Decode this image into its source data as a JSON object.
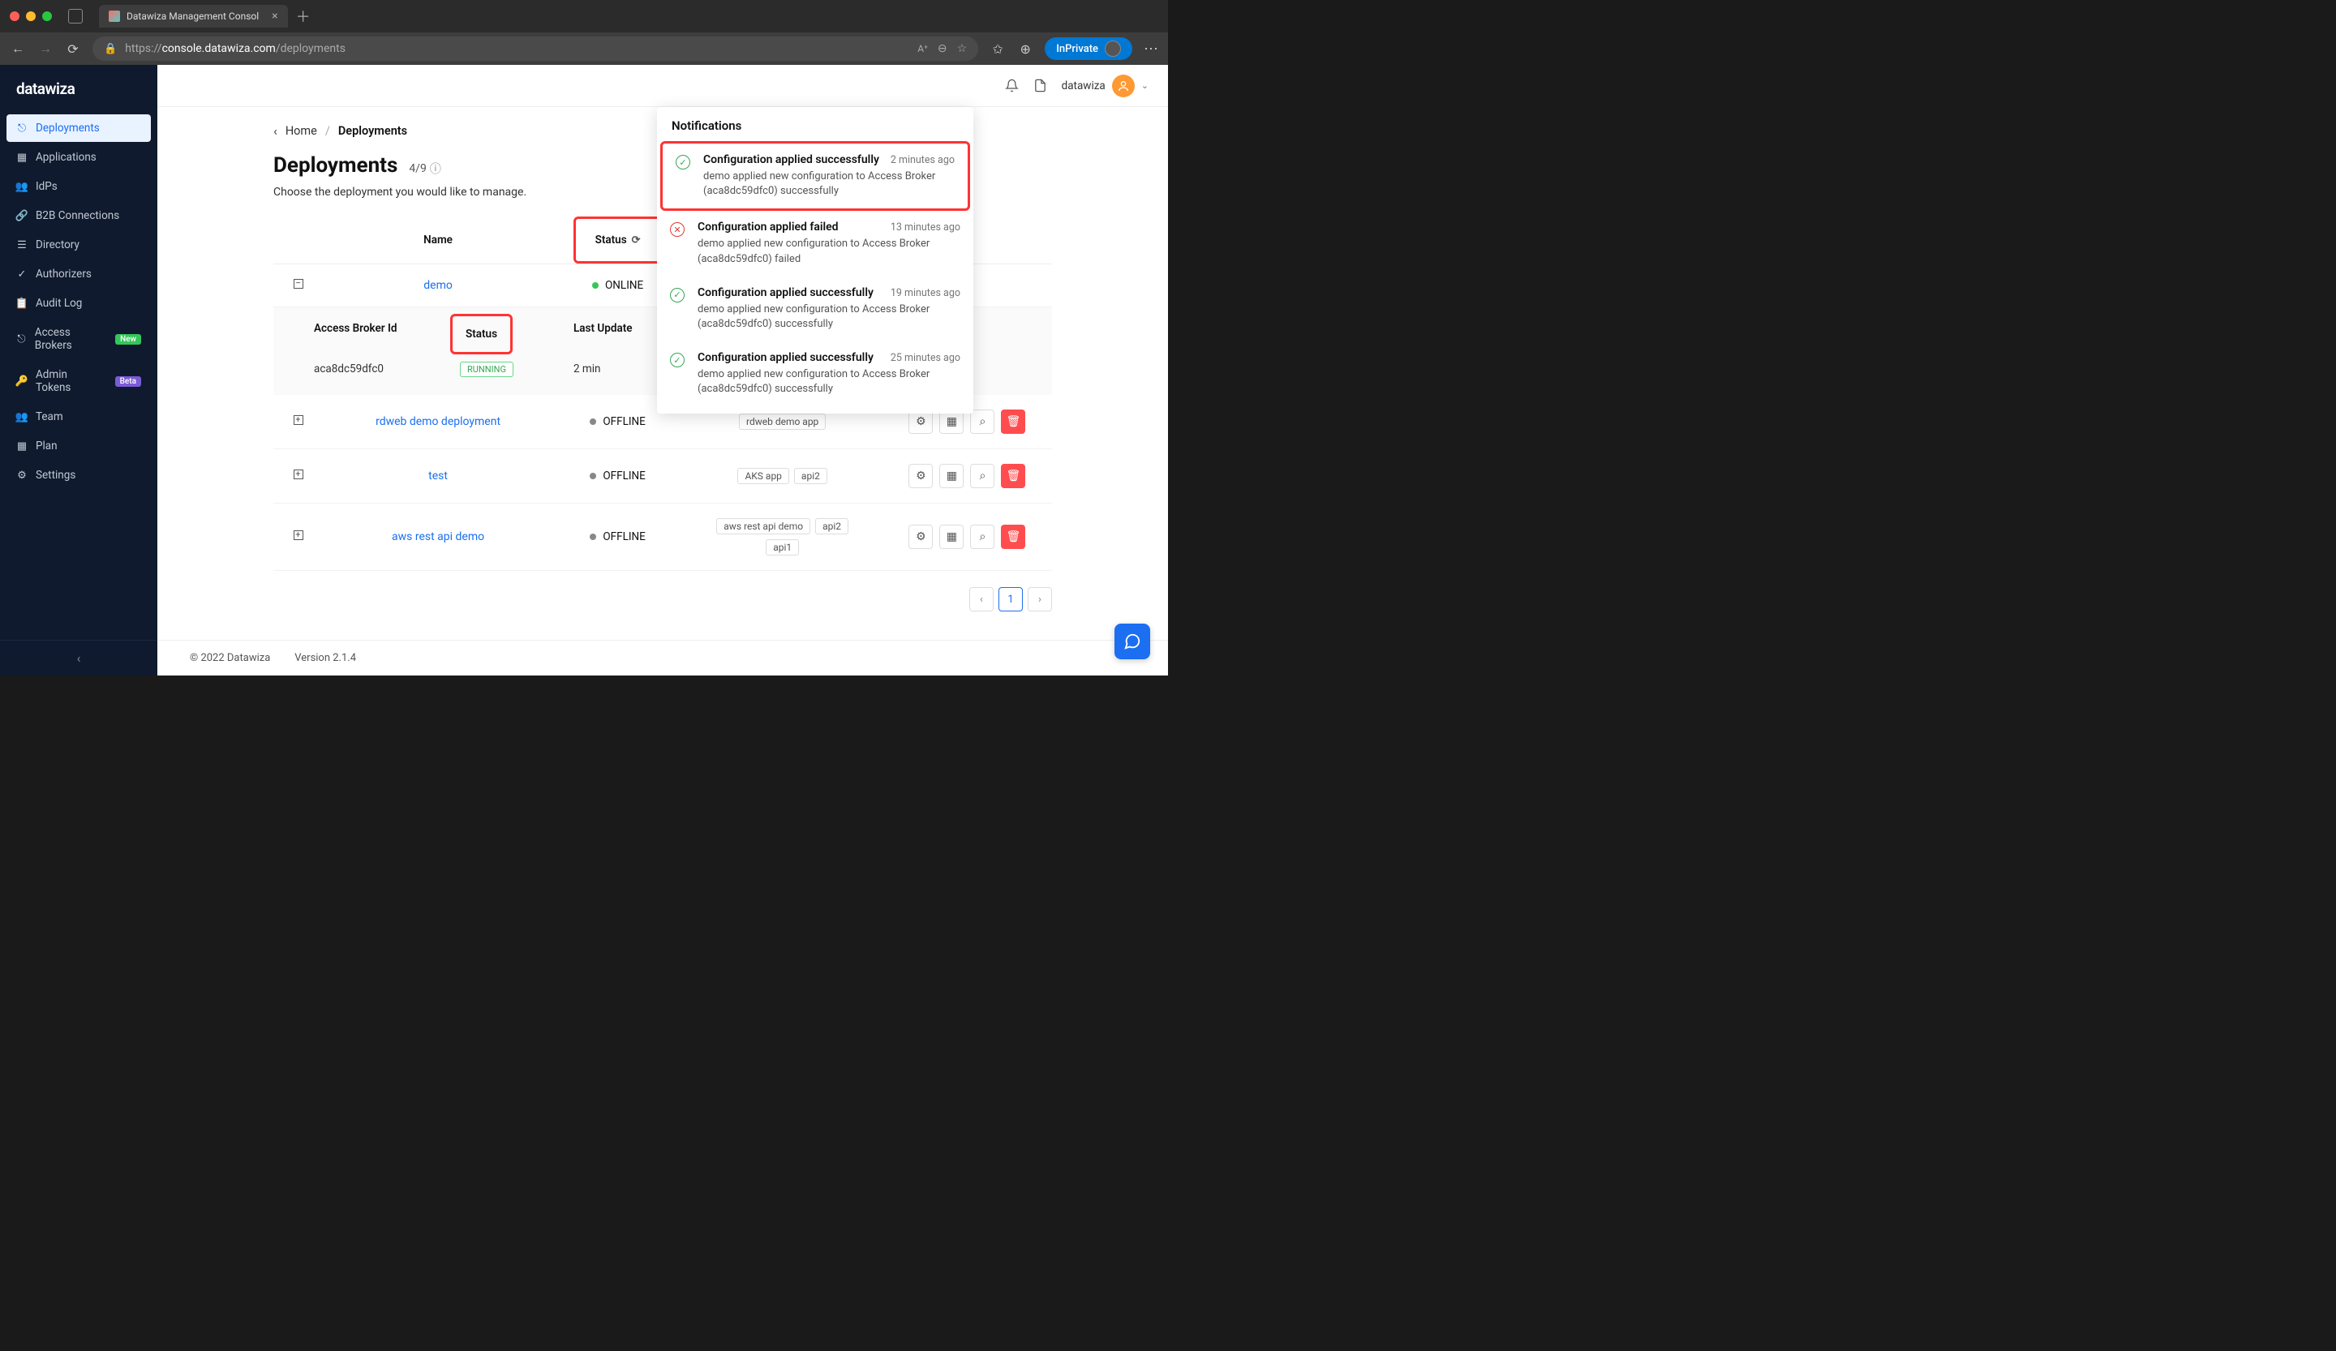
{
  "browser": {
    "tab_title": "Datawiza Management Consol",
    "url_prefix": "https://",
    "url_domain": "console.datawiza.com",
    "url_path": "/deployments",
    "inprivate": "InPrivate"
  },
  "sidebar": {
    "logo": "datawiza",
    "items": [
      {
        "label": "Deployments",
        "active": true
      },
      {
        "label": "Applications"
      },
      {
        "label": "IdPs"
      },
      {
        "label": "B2B Connections"
      },
      {
        "label": "Directory"
      },
      {
        "label": "Authorizers"
      },
      {
        "label": "Audit Log"
      },
      {
        "label": "Access Brokers",
        "badge": "New",
        "badge_class": "new"
      },
      {
        "label": "Admin Tokens",
        "badge": "Beta",
        "badge_class": "beta"
      },
      {
        "label": "Team"
      },
      {
        "label": "Plan"
      },
      {
        "label": "Settings"
      }
    ]
  },
  "topbar": {
    "username": "datawiza"
  },
  "breadcrumb": {
    "home": "Home",
    "current": "Deployments"
  },
  "page": {
    "title": "Deployments",
    "count": "4/9",
    "subtitle": "Choose the deployment you would like to manage."
  },
  "table": {
    "headers": {
      "name": "Name",
      "status": "Status"
    },
    "rows": [
      {
        "expand": "minus",
        "name": "demo",
        "status": "ONLINE",
        "dot": "online"
      },
      {
        "expand": "plus",
        "name": "rdweb demo deployment",
        "status": "OFFLINE",
        "dot": "offline",
        "apps": [
          "rdweb demo app"
        ]
      },
      {
        "expand": "plus",
        "name": "test",
        "status": "OFFLINE",
        "dot": "offline",
        "apps": [
          "AKS app",
          "api2"
        ]
      },
      {
        "expand": "plus",
        "name": "aws rest api demo",
        "status": "OFFLINE",
        "dot": "offline",
        "apps": [
          "aws rest api demo",
          "api2",
          "api1"
        ]
      }
    ]
  },
  "subtable": {
    "headers": {
      "id": "Access Broker Id",
      "status": "Status",
      "last": "Last Update"
    },
    "row": {
      "id": "aca8dc59dfc0",
      "status": "RUNNING",
      "last": "2 min"
    }
  },
  "pagination": {
    "current": "1"
  },
  "footer": {
    "copyright": "© 2022 Datawiza",
    "version": "Version 2.1.4"
  },
  "notifications": {
    "header": "Notifications",
    "items": [
      {
        "type": "success",
        "title": "Configuration applied successfully",
        "time": "2 minutes ago",
        "desc": "demo applied new configuration to Access Broker (aca8dc59dfc0) successfully",
        "highlight": true
      },
      {
        "type": "fail",
        "title": "Configuration applied failed",
        "time": "13 minutes ago",
        "desc": "demo applied new configuration to Access Broker (aca8dc59dfc0) failed"
      },
      {
        "type": "success",
        "title": "Configuration applied successfully",
        "time": "19 minutes ago",
        "desc": "demo applied new configuration to Access Broker (aca8dc59dfc0) successfully"
      },
      {
        "type": "success",
        "title": "Configuration applied successfully",
        "time": "25 minutes ago",
        "desc": "demo applied new configuration to Access Broker (aca8dc59dfc0) successfully"
      }
    ]
  }
}
